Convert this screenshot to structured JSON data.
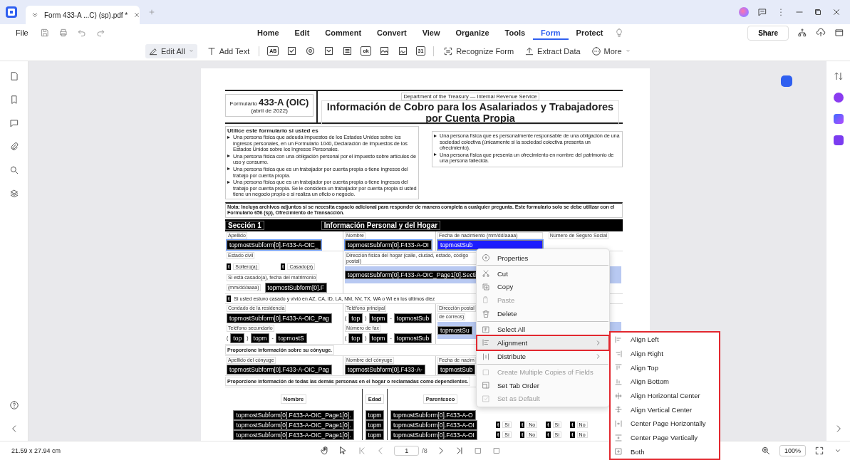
{
  "tab": {
    "title": "Form 433-A ...C) (sp).pdf *"
  },
  "menu": {
    "file": "File",
    "items": [
      {
        "label": "Home",
        "selected": false
      },
      {
        "label": "Edit",
        "selected": false
      },
      {
        "label": "Comment",
        "selected": false
      },
      {
        "label": "Convert",
        "selected": false
      },
      {
        "label": "View",
        "selected": false
      },
      {
        "label": "Organize",
        "selected": false
      },
      {
        "label": "Tools",
        "selected": false
      },
      {
        "label": "Form",
        "selected": true
      },
      {
        "label": "Protect",
        "selected": false
      }
    ],
    "share": "Share"
  },
  "toolbar": {
    "edit_all": "Edit All",
    "add_text": "Add Text",
    "field_tools": [
      {
        "kind": "text",
        "label": "AB"
      },
      {
        "kind": "checkbox"
      },
      {
        "kind": "radio"
      },
      {
        "kind": "dropdown"
      },
      {
        "kind": "listbox"
      },
      {
        "kind": "button",
        "label": "ok"
      },
      {
        "kind": "image"
      },
      {
        "kind": "signature"
      },
      {
        "kind": "date",
        "label": "31"
      }
    ],
    "recognize_form": "Recognize Form",
    "extract_data": "Extract Data",
    "more": "More"
  },
  "document": {
    "form_label": "Formulario",
    "form_number": "433-A (OIC)",
    "form_date": "(abril de 2022)",
    "department": "Department of the Treasury — Internal Revenue Service",
    "title": "Información de Cobro para los Asalariados y Trabajadores por Cuenta Propia",
    "intro_heading": "Utilice este formulario si usted es",
    "bullets_left": [
      "Una persona física que adeuda impuestos de los Estados Unidos sobre los ingresos personales, en un Formulario 1040, Declaración de Impuestos de los Estados Unidos sobre los Ingresos Personales.",
      "Una persona física con una obligación personal por el impuesto sobre artículos de uso y consumo.",
      "Una persona física que es un trabajador por cuenta propia o tiene ingresos del trabajo por cuenta propia.",
      "Una persona física que es un trabajador por cuenta propia o tiene ingresos del trabajo por cuenta propia. Se le considera un trabajador por cuenta propia si usted tiene un negocio propio o si realiza un oficio o negocio."
    ],
    "bullets_right": [
      "Una persona física que es personalmente responsable de una obligación de una sociedad colectiva (únicamente si la sociedad colectiva presenta un ofrecimiento).",
      "Una persona física que presenta un ofrecimiento en nombre del patrimonio de una persona fallecida."
    ],
    "note": "Nota: Incluya archivos adjuntos si se necesita espacio adicional para responder de manera completa a cualquier pregunta. Este formulario solo se debe utilizar con el Formulario 656 (sp), Ofrecimiento de Transacción.",
    "section_number": "Sección 1",
    "section_title": "Información Personal y del Hogar",
    "apellido": {
      "label": "Apellido",
      "field": {
        "value": "topmostSubform[0].F433-A-OIC_",
        "selected": true,
        "focused": false
      }
    },
    "nombre": {
      "label": "Nombre",
      "field": {
        "value": "topmostSubform[0].F433-A-OI",
        "selected": true,
        "focused": false
      }
    },
    "fecha_nacimiento": {
      "label": "Fecha de nacimiento (mm/dd/aaaa)",
      "field": {
        "value": "topmostSub",
        "selected": true,
        "focused": true
      }
    },
    "ssn_label": "Número de Seguro Social",
    "estado_civil": {
      "label": "Estado civil",
      "options": [
        {
          "mark": "t",
          "checked": false,
          "label": "Soltero(a)"
        },
        {
          "mark": "t",
          "checked": false,
          "label": "Casado(a)"
        }
      ]
    },
    "fecha_matrimonio": {
      "label": "Si está casado(a), fecha del matrimonio",
      "hint": "(mm/dd/aaaa)",
      "field": {
        "value": "topmostSubform[0].F"
      }
    },
    "direccion": {
      "label": "Dirección física del hogar (calle, ciudad, estado, código postal)",
      "field": {
        "value": "topmostSubform[0].F433-A-OIC_Page1[0].Secti"
      }
    },
    "community": {
      "mark": "t",
      "checked": false,
      "text": "Si usted estuvo casado y vivió en AZ, CA, ID, LA, NM, NV, TX, WA o WI en los últimos diez"
    },
    "condado": {
      "label": "Condado de la residencia",
      "field": {
        "value": "topmostSubform[0].F433-A-OIC_Pag"
      }
    },
    "telefono_principal": {
      "label": "Teléfono principal",
      "open": "(",
      "close": ")",
      "dash": "-",
      "parts": [
        "top",
        "topm",
        "topmostSub"
      ]
    },
    "direccion_postal": {
      "label_lines": [
        "Dirección postal",
        "de correos)"
      ],
      "field": {
        "value": "topmostSu"
      }
    },
    "telefono_secundario": {
      "label": "Teléfono secundario",
      "open": "(",
      "close": ")",
      "dash": "-",
      "parts": [
        "top",
        "topm",
        "topmostS"
      ]
    },
    "fax": {
      "label": "Número de fax",
      "open": "(",
      "close": ")",
      "dash": "-",
      "parts": [
        "top",
        "topm",
        "topmostSub"
      ]
    },
    "spouse_heading": "Proporcione información sobre su cónyuge.",
    "apellido_conyuge": {
      "label": "Apellido del cónyuge",
      "field": {
        "value": "topmostSubform[0].F433-A-OIC_Pag"
      }
    },
    "nombre_conyuge": {
      "label": "Nombre del cónyuge",
      "field": {
        "value": "topmostSubform[0].F433-A-"
      }
    },
    "fecha_conyuge": {
      "label": "Fecha de nacim",
      "field": {
        "value": "topmostSub"
      }
    },
    "dependents_heading": "Proporcione información de todas las demás personas en el hogar o reclamadas como dependientes.",
    "dependents": {
      "headers": [
        "Nombre",
        "Edad",
        "Parentesco"
      ],
      "rows": [
        {
          "cells": [
            "topmostSubform[0].F433-A-OIC_Page1[0].",
            "topm",
            "topmostSubform[0].F433-A-O"
          ],
          "answers": []
        },
        {
          "cells": [
            "topmostSubform[0].F433-A-OIC_Page1[0].",
            "topm",
            "topmostSubform[0].F433-A-OI"
          ],
          "answers": [
            {
              "mark": "t",
              "checked": false,
              "label": "Sí"
            },
            {
              "mark": "t",
              "checked": false,
              "label": "No"
            },
            {
              "mark": "t",
              "checked": false,
              "label": "Sí"
            },
            {
              "mark": "t",
              "checked": false,
              "label": "No"
            }
          ]
        },
        {
          "cells": [
            "topmostSubform[0].F433-A-OIC_Page1[0].",
            "topm",
            "topmostSubform[0].F433-A-OI"
          ],
          "answers": [
            {
              "mark": "t",
              "checked": false,
              "label": "Sí"
            },
            {
              "mark": "t",
              "checked": false,
              "label": "No"
            },
            {
              "mark": "t",
              "checked": false,
              "label": "Sí"
            },
            {
              "mark": "t",
              "checked": false,
              "label": "No"
            }
          ]
        }
      ]
    }
  },
  "context_menu": {
    "items": [
      {
        "kind": "properties",
        "label": "Properties",
        "disabled": false,
        "submenu": false,
        "selected": false,
        "divider_after": true
      },
      {
        "kind": "cut",
        "label": "Cut",
        "disabled": false,
        "submenu": false,
        "selected": false,
        "divider_after": false
      },
      {
        "kind": "copy",
        "label": "Copy",
        "disabled": false,
        "submenu": false,
        "selected": false,
        "divider_after": false
      },
      {
        "kind": "paste",
        "label": "Paste",
        "disabled": true,
        "submenu": false,
        "selected": false,
        "divider_after": false
      },
      {
        "kind": "delete",
        "label": "Delete",
        "disabled": false,
        "submenu": false,
        "selected": false,
        "divider_after": true
      },
      {
        "kind": "select-all",
        "label": "Select All",
        "disabled": false,
        "submenu": false,
        "selected": false,
        "divider_after": false
      },
      {
        "kind": "alignment",
        "label": "Alignment",
        "disabled": false,
        "submenu": true,
        "selected": true,
        "divider_after": false
      },
      {
        "kind": "distribute",
        "label": "Distribute",
        "disabled": false,
        "submenu": true,
        "selected": false,
        "divider_after": true
      },
      {
        "kind": "copies",
        "label": "Create Multiple Copies of Fields",
        "disabled": true,
        "submenu": false,
        "selected": false,
        "divider_after": false
      },
      {
        "kind": "tab-order",
        "label": "Set Tab Order",
        "disabled": false,
        "submenu": false,
        "selected": false,
        "divider_after": false
      },
      {
        "kind": "default",
        "label": "Set as Default",
        "disabled": true,
        "submenu": false,
        "selected": false,
        "divider_after": false
      }
    ]
  },
  "submenu": {
    "items": [
      {
        "kind": "left",
        "label": "Align Left"
      },
      {
        "kind": "right",
        "label": "Align Right"
      },
      {
        "kind": "top",
        "label": "Align Top"
      },
      {
        "kind": "bottom",
        "label": "Align Bottom"
      },
      {
        "kind": "hcenter",
        "label": "Align Horizontal Center"
      },
      {
        "kind": "vcenter",
        "label": "Align Vertical Center"
      },
      {
        "kind": "page-h",
        "label": "Center Page Horizontally"
      },
      {
        "kind": "page-v",
        "label": "Center Page Vertically"
      },
      {
        "kind": "both",
        "label": "Both"
      }
    ]
  },
  "status_bar": {
    "page_size": "21.59 x 27.94 cm",
    "page": "1",
    "total": "/8",
    "zoom": "100%"
  }
}
